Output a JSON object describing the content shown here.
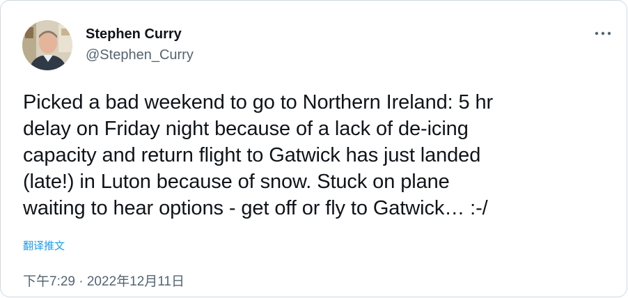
{
  "author": {
    "name": "Stephen Curry",
    "handle": "@Stephen_Curry"
  },
  "tweet": {
    "lines": [
      "Picked a bad weekend to go to Northern Ireland: 5 hr",
      "delay on Friday night because of a lack of de-icing",
      "capacity and return flight to Gatwick has just landed",
      "(late!) in Luton because of snow. Stuck on plane",
      "waiting to hear options - get off or fly to Gatwick… :-/"
    ],
    "translate_label": "翻译推文",
    "timestamp": "下午7:29 · 2022年12月11日"
  },
  "icons": {
    "more": "more-horizontal-icon",
    "avatar": "avatar-photo"
  },
  "colors": {
    "text_primary": "#0f1419",
    "text_secondary": "#536471",
    "link": "#1d9bf0",
    "border": "#cfd9de"
  }
}
